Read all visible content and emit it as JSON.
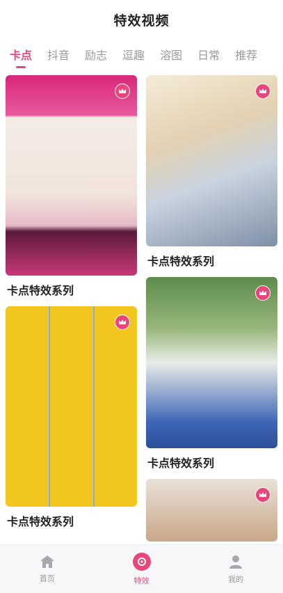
{
  "header": {
    "title": "特效视频"
  },
  "tabs": [
    {
      "label": "卡点",
      "active": true
    },
    {
      "label": "抖音",
      "active": false
    },
    {
      "label": "励志",
      "active": false
    },
    {
      "label": "逗趣",
      "active": false
    },
    {
      "label": "溶图",
      "active": false
    },
    {
      "label": "日常",
      "active": false
    },
    {
      "label": "推荐",
      "active": false
    }
  ],
  "cards": [
    {
      "title": "卡点特效系列",
      "badge_icon": "crown-icon"
    },
    {
      "title": "卡点特效系列",
      "badge_icon": "crown-icon"
    },
    {
      "title": "卡点特效系列",
      "badge_icon": "crown-icon"
    },
    {
      "title": "卡点特效系列",
      "badge_icon": "crown-icon"
    },
    {
      "badge_icon": "crown-icon"
    }
  ],
  "bottom_nav": [
    {
      "label": "首页",
      "icon": "home-icon",
      "active": false
    },
    {
      "label": "特效",
      "icon": "effects-icon",
      "active": true
    },
    {
      "label": "我的",
      "icon": "user-icon",
      "active": false
    }
  ],
  "colors": {
    "accent": "#e8457a",
    "inactive": "#9a9a9a"
  }
}
